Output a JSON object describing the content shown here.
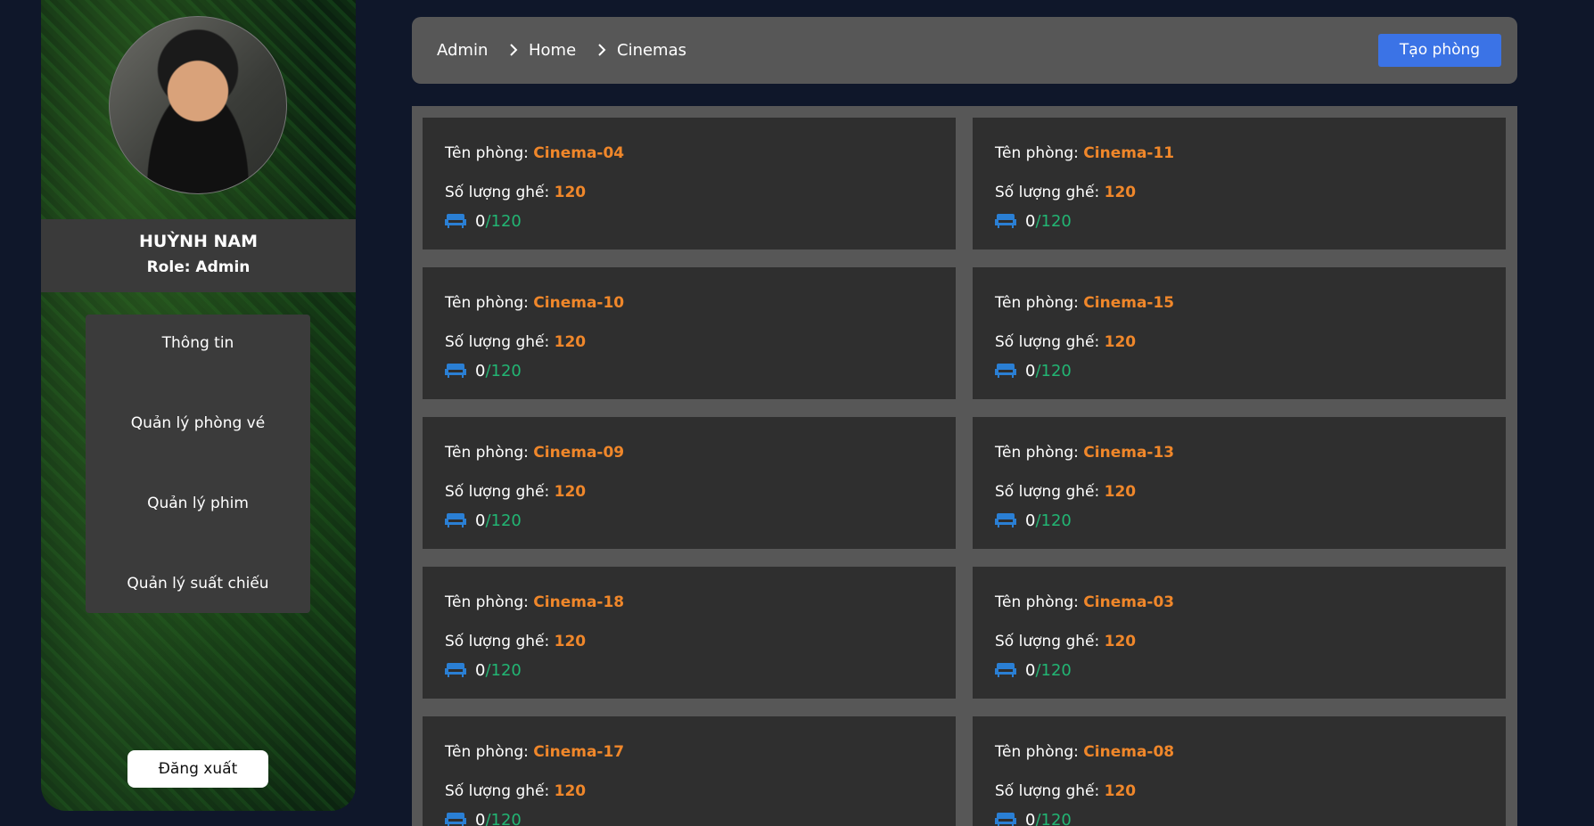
{
  "sidebar": {
    "name": "HUỲNH NAM",
    "role": "Role: Admin",
    "menu": [
      {
        "label": "Thông tin"
      },
      {
        "label": "Quản lý phòng vé"
      },
      {
        "label": "Quản lý phim"
      },
      {
        "label": "Quản lý suất chiếu"
      }
    ],
    "logout": "Đăng xuất"
  },
  "breadcrumb": [
    "Admin",
    "Home",
    "Cinemas"
  ],
  "create_button": "Tạo phòng",
  "labels": {
    "room": "Tên phòng:",
    "seats": "Số lượng ghế:"
  },
  "cinemas": [
    {
      "name": "Cinema-04",
      "seats": "120",
      "booked": "0",
      "total": "/120"
    },
    {
      "name": "Cinema-11",
      "seats": "120",
      "booked": "0",
      "total": "/120"
    },
    {
      "name": "Cinema-10",
      "seats": "120",
      "booked": "0",
      "total": "/120"
    },
    {
      "name": "Cinema-15",
      "seats": "120",
      "booked": "0",
      "total": "/120"
    },
    {
      "name": "Cinema-09",
      "seats": "120",
      "booked": "0",
      "total": "/120"
    },
    {
      "name": "Cinema-13",
      "seats": "120",
      "booked": "0",
      "total": "/120"
    },
    {
      "name": "Cinema-18",
      "seats": "120",
      "booked": "0",
      "total": "/120"
    },
    {
      "name": "Cinema-03",
      "seats": "120",
      "booked": "0",
      "total": "/120"
    },
    {
      "name": "Cinema-17",
      "seats": "120",
      "booked": "0",
      "total": "/120"
    },
    {
      "name": "Cinema-08",
      "seats": "120",
      "booked": "0",
      "total": "/120"
    }
  ],
  "colors": {
    "accent_orange": "#f0872a",
    "accent_green": "#22b573",
    "seat_icon": "#2a7fd4",
    "button_blue": "#3b73e6"
  }
}
